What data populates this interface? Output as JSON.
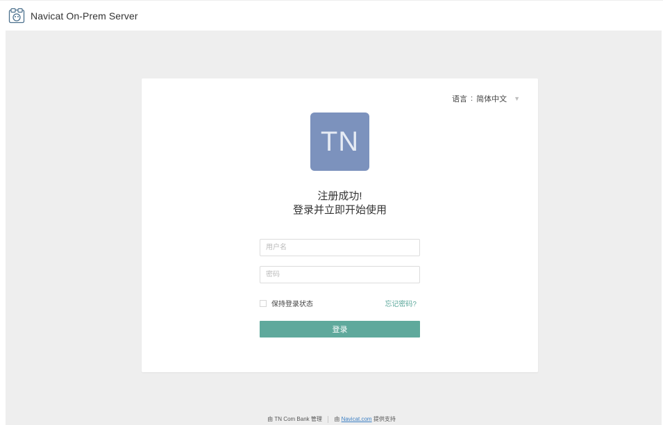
{
  "app": {
    "title": "Navicat On-Prem Server",
    "logo_icon": "navicat-logo-icon"
  },
  "card": {
    "language": {
      "label": "语言",
      "separator": ":",
      "value": "简体中文",
      "caret_icon": "caret-down-icon"
    },
    "avatar_text": "TN",
    "avatar_color": "#7c92bd",
    "message_line1": "注册成功!",
    "message_line2": "登录并立即开始使用",
    "username_placeholder": "用户名",
    "password_placeholder": "密码",
    "remember_label": "保持登录状态",
    "forgot_label": "忘记密码?",
    "login_label": "登录",
    "accent_color": "#5fa99c"
  },
  "footer": {
    "managed_by_prefix": "由",
    "managed_by_name": "TN Com Bank",
    "managed_by_suffix": "管理",
    "powered_prefix": "由",
    "powered_link": "Navicat.com",
    "powered_suffix": "提供支持"
  }
}
